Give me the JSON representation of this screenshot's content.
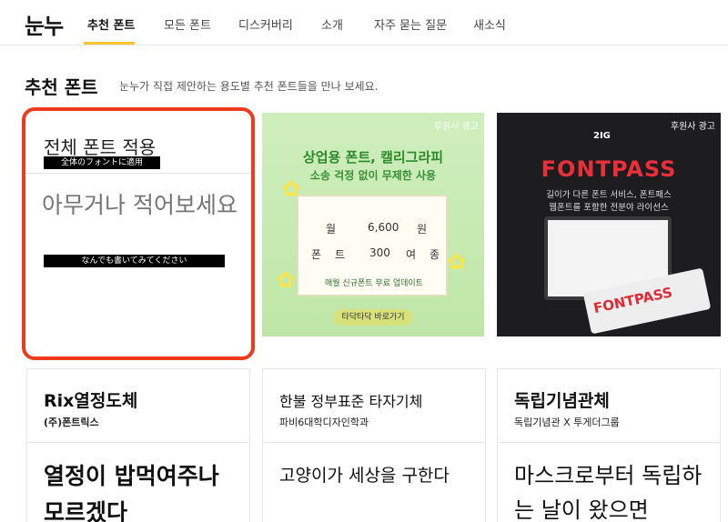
{
  "nav": {
    "logo": "눈누",
    "tabs": [
      {
        "label": "추천 폰트",
        "active": true
      },
      {
        "label": "모든 폰트"
      },
      {
        "label": "디스커버리"
      },
      {
        "label": "소개"
      },
      {
        "label": "자주 묻는 질문"
      },
      {
        "label": "새소식"
      }
    ],
    "accent_color": "#f4c531"
  },
  "section": {
    "title": "추천 폰트",
    "description": "눈누가 직접 제안하는 용도별 추천 폰트들을 만나 보세요."
  },
  "apply_card": {
    "title": "전체 폰트 적용",
    "title_translation": "全体のフォントに適用",
    "placeholder": "아무거나 적어보세요",
    "placeholder_translation": "なんでも書いてみてください",
    "border_color": "#f03a1f"
  },
  "ads": [
    {
      "tag": "후원사 광고",
      "title": "상업용 폰트, 캘리그라피",
      "subtitle": "소송 걱정 없이 무제한 사용",
      "rows": [
        [
          "월",
          "6,600",
          "원"
        ],
        [
          "폰",
          "트",
          "300",
          "여",
          "종"
        ]
      ],
      "footer": "매월 신규폰트 무료 업데이트",
      "button": "타닥타닥 바로가기"
    },
    {
      "tag": "후원사 광고",
      "logo": "2IG",
      "title": "FONTPASS",
      "line1": "길이가 다른 폰트 서비스, 폰트패스",
      "line2": "웹폰트를 포함한 전분야 라이선스",
      "ticket": "FONTPASS",
      "brand_color": "#ea2f3a"
    }
  ],
  "font_cards": [
    {
      "name": "Rix열정도체",
      "maker": "(주)폰트릭스",
      "sample": "열정이 밥먹여주나 모르겠다"
    },
    {
      "name": "한불 정부표준 타자기체",
      "maker": "파비6대학디자인학과",
      "sample": "고양이가 세상을 구한다"
    },
    {
      "name": "독립기념관체",
      "maker": "독립기념관 X 투게더그룹",
      "sample": "마스크로부터 독립하는 날이 왔으면"
    }
  ]
}
